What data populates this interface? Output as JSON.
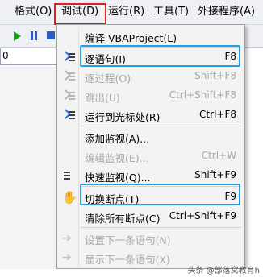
{
  "menubar": {
    "items": [
      {
        "label": "格式(O)"
      },
      {
        "label": "调试(D)"
      },
      {
        "label": "运行(R)"
      },
      {
        "label": "工具(T)"
      },
      {
        "label": "外接程序(A)"
      }
    ]
  },
  "toolbar": {
    "buttons": [
      {
        "icon": "run-icon"
      },
      {
        "icon": "pause-icon"
      },
      {
        "icon": "stop-icon"
      }
    ]
  },
  "code_area": {
    "value": "0"
  },
  "debug_menu": {
    "items": [
      {
        "label": "编译 VBAProject(L)",
        "shortcut": "",
        "icon": ""
      },
      {
        "label": "逐语句(I)",
        "shortcut": "F8",
        "icon": "step-into-icon"
      },
      {
        "label": "逐过程(O)",
        "shortcut": "Shift+F8",
        "icon": "step-over-icon",
        "disabled": true
      },
      {
        "label": "跳出(U)",
        "shortcut": "Ctrl+Shift+F8",
        "icon": "step-out-icon",
        "disabled": true
      },
      {
        "label": "运行到光标处(R)",
        "shortcut": "Ctrl+F8",
        "icon": "run-to-cursor-icon"
      },
      {
        "label": "添加监视(A)...",
        "shortcut": "",
        "icon": ""
      },
      {
        "label": "编辑监视(E)...",
        "shortcut": "Ctrl+W",
        "icon": "",
        "disabled": true
      },
      {
        "label": "快速监视(Q)...",
        "shortcut": "Shift+F9",
        "icon": "quick-watch-icon"
      },
      {
        "label": "切换断点(T)",
        "shortcut": "F9",
        "icon": "hand-icon"
      },
      {
        "label": "清除所有断点(C)",
        "shortcut": "Ctrl+Shift+F9",
        "icon": ""
      },
      {
        "label": "设置下一条语句(N)",
        "shortcut": "",
        "icon": "set-next-arrow-icon",
        "disabled": true
      },
      {
        "label": "显示下一条语句(X)",
        "shortcut": "",
        "icon": "show-next-arrow-icon",
        "disabled": true
      }
    ]
  },
  "watermark": "头条 @部落窝教育h",
  "colors": {
    "highlight_red": "#e02020",
    "highlight_blue": "#1e9fe6"
  }
}
